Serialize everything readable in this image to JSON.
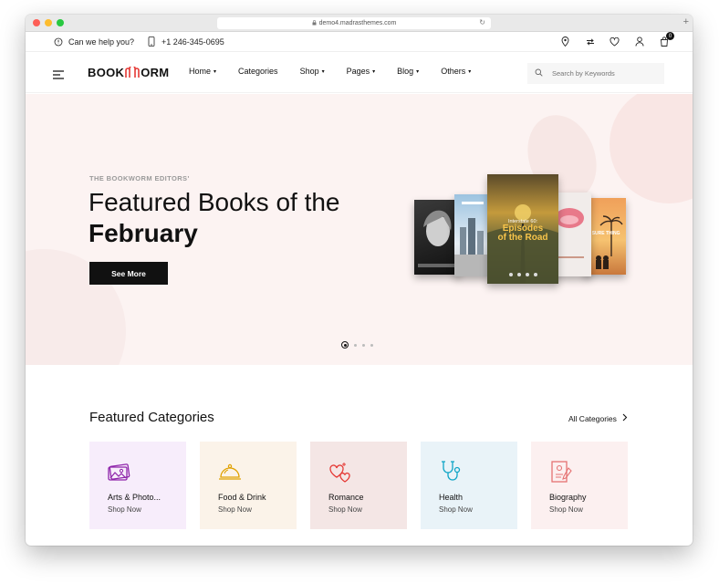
{
  "browser": {
    "url": "demo4.madrasthemes.com"
  },
  "topbar": {
    "help": "Can we help you?",
    "phone": "+1 246-345-0695",
    "cart_count": "0"
  },
  "logo": {
    "left": "BOOK",
    "right": "ORM"
  },
  "nav": {
    "items": [
      {
        "label": "Home",
        "dropdown": true
      },
      {
        "label": "Categories",
        "dropdown": false
      },
      {
        "label": "Shop",
        "dropdown": true
      },
      {
        "label": "Pages",
        "dropdown": true
      },
      {
        "label": "Blog",
        "dropdown": true
      },
      {
        "label": "Others",
        "dropdown": true
      }
    ],
    "search_placeholder": "Search by Keywords"
  },
  "hero": {
    "eyebrow": "THE BOOKWORM EDITORS'",
    "title_line1": "Featured Books of the",
    "title_line2": "February",
    "cta": "See More",
    "featured_book": {
      "title_top": "Interstate 60:",
      "title_line1": "Episodes",
      "title_line2": "of the Road"
    },
    "side_book_text": "E SURE THING",
    "slide_count": 4,
    "active_slide": 0
  },
  "categories": {
    "title": "Featured Categories",
    "all_label": "All Categories",
    "items": [
      {
        "name": "Arts & Photo...",
        "shop": "Shop Now",
        "bg": "#f7edfb",
        "icon": "arts-photo-icon",
        "color": "#8e24aa"
      },
      {
        "name": "Food & Drink",
        "shop": "Shop Now",
        "bg": "#fbf3e9",
        "icon": "food-drink-icon",
        "color": "#e0a100"
      },
      {
        "name": "Romance",
        "shop": "Shop Now",
        "bg": "#f4e6e5",
        "icon": "romance-icon",
        "color": "#e53935"
      },
      {
        "name": "Health",
        "shop": "Shop Now",
        "bg": "#e9f3f8",
        "icon": "health-icon",
        "color": "#0ea5c6"
      },
      {
        "name": "Biography",
        "shop": "Shop Now",
        "bg": "#fcf0f0",
        "icon": "biography-icon",
        "color": "#e57373"
      }
    ]
  },
  "colors": {
    "accent": "#e53935",
    "hero_bg": "#fcf3f2",
    "dark": "#111111"
  }
}
